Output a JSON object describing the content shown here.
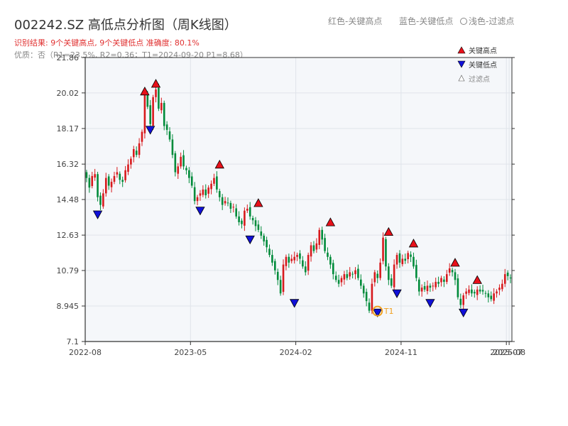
{
  "header": {
    "title": "002242.SZ 高低点分析图（周K线图）",
    "result_text": "识别结果: 9个关键高点, 9个关键低点  准确度: 80.1%",
    "quality_text": "优质：否（R1=23.5%, R2=0.36；T1=2024-09-20 P1=8.68）"
  },
  "top_legend": {
    "red": "红色-关键高点",
    "blue": "蓝色-关键低点",
    "light": "浅色-过滤点"
  },
  "legend": {
    "high": "关键高点",
    "low": "关键低点",
    "filtered": "过滤点"
  },
  "colors": {
    "up": "#d7191c",
    "down": "#008b3a",
    "high_marker": "#e8101a",
    "low_marker": "#1010d8",
    "t1": "#f0a020",
    "plot_bg": "#f5f7fa"
  },
  "chart_data": {
    "type": "candlestick",
    "ylim": [
      7.1,
      21.86
    ],
    "yticks": [
      7.1,
      8.945,
      10.79,
      12.63,
      14.48,
      16.32,
      18.17,
      20.02,
      21.86
    ],
    "xtick_labels": [
      "2022-08",
      "2023-05",
      "2024-02",
      "2024-11",
      "2025-07",
      "2025-08"
    ],
    "xtick_weeks": [
      0,
      38,
      76,
      114,
      152,
      153
    ],
    "total_weeks": 154,
    "closes": [
      15.6,
      15.1,
      15.7,
      15.8,
      14.6,
      14.2,
      14.8,
      15.6,
      15.2,
      15.4,
      15.7,
      15.9,
      15.5,
      15.4,
      16.0,
      16.3,
      16.6,
      17.1,
      16.8,
      17.4,
      18.0,
      19.9,
      19.3,
      18.4,
      19.8,
      20.2,
      19.2,
      19.5,
      18.3,
      18.1,
      17.6,
      16.8,
      15.9,
      16.2,
      16.7,
      16.2,
      16.0,
      15.6,
      15.2,
      14.4,
      14.6,
      14.8,
      15.0,
      14.7,
      15.1,
      15.3,
      15.6,
      15.0,
      14.6,
      14.2,
      14.4,
      14.3,
      14.0,
      14.1,
      13.6,
      13.3,
      13.2,
      13.9,
      14.0,
      13.6,
      13.4,
      13.1,
      12.9,
      12.6,
      12.3,
      12.0,
      11.6,
      11.2,
      10.8,
      10.3,
      9.6,
      11.1,
      11.5,
      11.2,
      11.4,
      11.5,
      11.6,
      11.4,
      11.0,
      10.7,
      11.6,
      12.1,
      11.8,
      12.2,
      12.9,
      12.4,
      11.8,
      11.5,
      11.1,
      10.6,
      10.3,
      10.1,
      10.4,
      10.6,
      10.4,
      10.7,
      10.6,
      10.8,
      10.4,
      10.0,
      9.6,
      9.2,
      8.7,
      10.1,
      10.7,
      10.4,
      11.2,
      12.5,
      11.0,
      10.3,
      10.0,
      11.1,
      11.6,
      11.2,
      11.4,
      11.3,
      11.7,
      11.5,
      11.0,
      10.4,
      9.7,
      9.9,
      9.8,
      10.0,
      9.9,
      10.0,
      10.2,
      10.1,
      10.4,
      10.2,
      10.6,
      10.9,
      10.7,
      10.3,
      9.4,
      9.0,
      9.5,
      9.7,
      9.8,
      9.6,
      9.6,
      9.8,
      9.7,
      9.7,
      9.6,
      9.4,
      9.3,
      9.6,
      9.7,
      9.9,
      10.1,
      10.6,
      10.5,
      10.4
    ],
    "key_highs": [
      {
        "week": 21,
        "price": 19.8
      },
      {
        "week": 25,
        "price": 20.2
      },
      {
        "week": 48,
        "price": 16.0
      },
      {
        "week": 62,
        "price": 14.0
      },
      {
        "week": 88,
        "price": 13.0
      },
      {
        "week": 109,
        "price": 12.5
      },
      {
        "week": 118,
        "price": 11.9
      },
      {
        "week": 133,
        "price": 10.9
      },
      {
        "week": 141,
        "price": 10.0
      }
    ],
    "key_lows": [
      {
        "week": 4,
        "price": 14.0
      },
      {
        "week": 23,
        "price": 18.4
      },
      {
        "week": 41,
        "price": 14.2
      },
      {
        "week": 59,
        "price": 12.7
      },
      {
        "week": 75,
        "price": 9.4
      },
      {
        "week": 105,
        "price": 8.9
      },
      {
        "week": 112,
        "price": 9.9
      },
      {
        "week": 124,
        "price": 9.4
      },
      {
        "week": 136,
        "price": 8.9
      }
    ],
    "t1": {
      "week": 105,
      "price": 8.68,
      "label": "T1"
    }
  }
}
